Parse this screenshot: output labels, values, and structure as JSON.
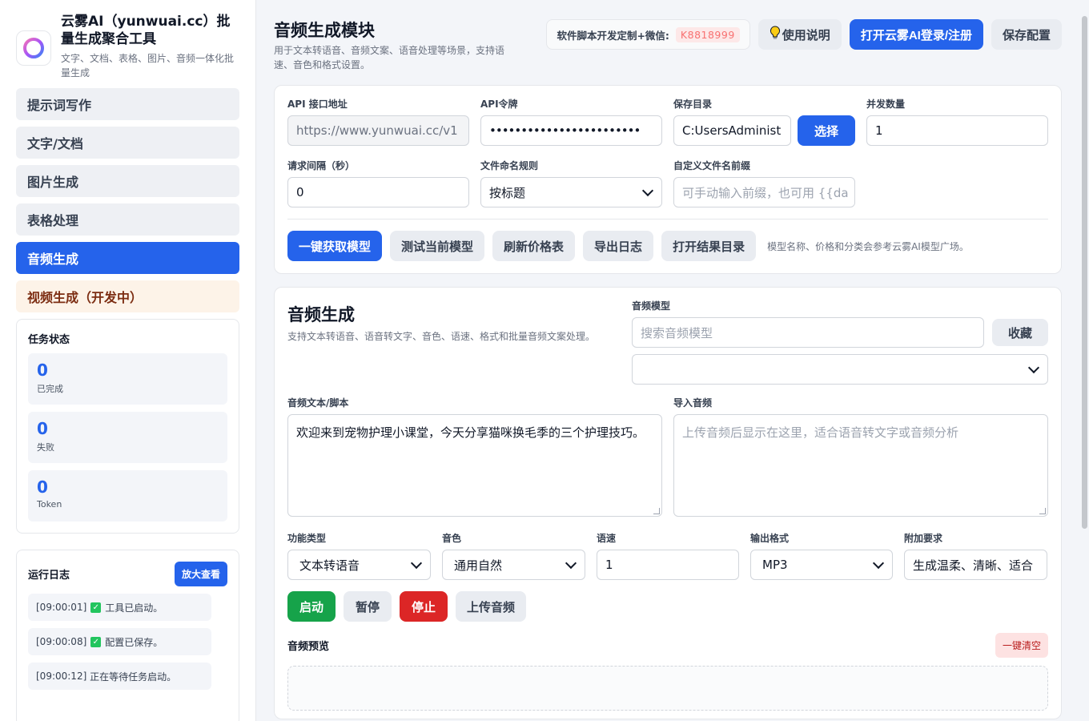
{
  "brand": {
    "title": "云雾AI（yunwuai.cc）批量生成聚合工具",
    "subtitle": "文字、文档、表格、图片、音频一体化批量生成"
  },
  "nav": [
    {
      "label": "提示词写作"
    },
    {
      "label": "文字/文档"
    },
    {
      "label": "图片生成"
    },
    {
      "label": "表格处理"
    },
    {
      "label": "音频生成"
    },
    {
      "label": "视频生成（开发中）"
    }
  ],
  "task_status": {
    "title": "任务状态",
    "items": [
      {
        "value": "0",
        "label": "已完成"
      },
      {
        "value": "0",
        "label": "失败"
      },
      {
        "value": "0",
        "label": "Token"
      }
    ]
  },
  "run_log": {
    "title": "运行日志",
    "zoom_label": "放大查看",
    "lines": [
      {
        "time": "[09:00:01]",
        "text": "工具已启动。",
        "ok": true
      },
      {
        "time": "[09:00:08]",
        "text": "配置已保存。",
        "ok": true
      },
      {
        "time": "[09:00:12]",
        "text": "正在等待任务启动。",
        "ok": false
      }
    ]
  },
  "header": {
    "title": "音频生成模块",
    "subtitle": "用于文本转语音、音频文案、语音处理等场景，支持语速、音色和格式设置。",
    "contact_label": "软件脚本开发定制+微信:",
    "contact_wechat": "K8818999",
    "help_label": "使用说明",
    "login_label": "打开云雾AI登录/注册",
    "save_label": "保存配置"
  },
  "config": {
    "api_url_label": "API 接口地址",
    "api_url_value": "https://www.yunwuai.cc/v1",
    "api_token_label": "API令牌",
    "api_token_value": "••••••••••••••••••••••••",
    "save_dir_label": "保存目录",
    "save_dir_value": "C:UsersAdminist",
    "choose_label": "选择",
    "concurrency_label": "并发数量",
    "concurrency_value": "1",
    "interval_label": "请求间隔（秒）",
    "interval_value": "0",
    "naming_label": "文件命名规则",
    "naming_value": "按标题",
    "prefix_label": "自定义文件名前缀",
    "prefix_placeholder": "可手动输入前缀，也可用 {{da",
    "tools": {
      "fetch_models": "一键获取模型",
      "test_model": "测试当前模型",
      "refresh_price": "刷新价格表",
      "export_log": "导出日志",
      "open_results": "打开结果目录"
    },
    "hint": "模型名称、价格和分类会参考云雾AI模型广场。"
  },
  "audio": {
    "title": "音频生成",
    "subtitle": "支持文本转语音、语音转文字、音色、语速、格式和批量音频文案处理。",
    "model_label": "音频模型",
    "model_search_placeholder": "搜索音频模型",
    "favorite_label": "收藏",
    "model_select_value": "",
    "script_label": "音频文本/脚本",
    "script_value": "欢迎来到宠物护理小课堂，今天分享猫咪换毛季的三个护理技巧。",
    "import_label": "导入音频",
    "import_placeholder": "上传音频后显示在这里，适合语音转文字或音频分析",
    "func_type_label": "功能类型",
    "func_type_value": "文本转语音",
    "voice_label": "音色",
    "voice_value": "通用自然",
    "speed_label": "语速",
    "speed_value": "1",
    "format_label": "输出格式",
    "format_value": "MP3",
    "extra_label": "附加要求",
    "extra_value": "生成温柔、清晰、适合",
    "start_label": "启动",
    "pause_label": "暂停",
    "stop_label": "停止",
    "upload_label": "上传音频",
    "preview_label": "音频预览",
    "clear_label": "一键清空"
  }
}
